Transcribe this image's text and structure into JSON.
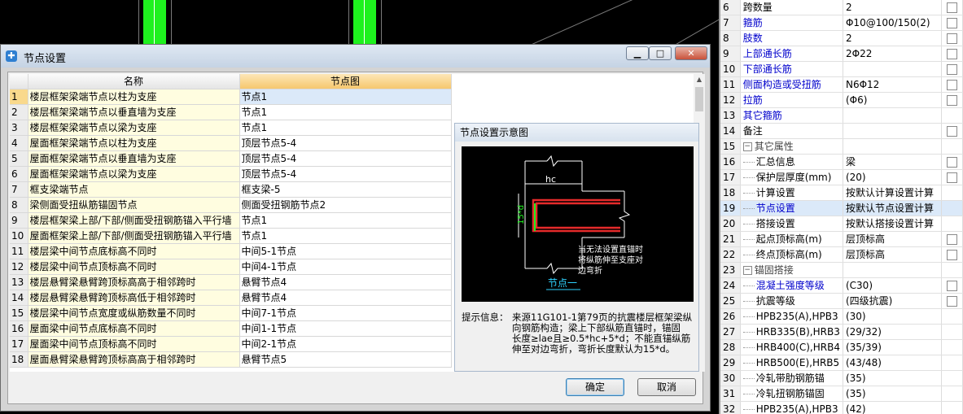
{
  "dialog": {
    "title": "节点设置",
    "window_buttons": {
      "minimize": "▁",
      "maximize": "□",
      "close": "✕"
    },
    "columns": {
      "name": "名称",
      "node": "节点图"
    },
    "rows": [
      {
        "num": "1",
        "name": "楼层框架梁端节点以柱为支座",
        "node": "节点1"
      },
      {
        "num": "2",
        "name": "楼层框架梁端节点以垂直墙为支座",
        "node": "节点1"
      },
      {
        "num": "3",
        "name": "楼层框架梁端节点以梁为支座",
        "node": "节点1"
      },
      {
        "num": "4",
        "name": "屋面框架梁端节点以柱为支座",
        "node": "顶层节点5-4"
      },
      {
        "num": "5",
        "name": "屋面框架梁端节点以垂直墙为支座",
        "node": "顶层节点5-4"
      },
      {
        "num": "6",
        "name": "屋面框架梁端节点以梁为支座",
        "node": "顶层节点5-4"
      },
      {
        "num": "7",
        "name": "框支梁端节点",
        "node": "框支梁-5"
      },
      {
        "num": "8",
        "name": "梁侧面受扭纵筋锚固节点",
        "node": "侧面受扭钢筋节点2"
      },
      {
        "num": "9",
        "name": "楼层框架梁上部/下部/侧面受扭钢筋锚入平行墙",
        "node": "节点1"
      },
      {
        "num": "10",
        "name": "屋面框架梁上部/下部/侧面受扭钢筋锚入平行墙",
        "node": "节点1"
      },
      {
        "num": "11",
        "name": "楼层梁中间节点底标高不同时",
        "node": "中间5-1节点"
      },
      {
        "num": "12",
        "name": "楼层梁中间节点顶标高不同时",
        "node": "中间4-1节点"
      },
      {
        "num": "13",
        "name": "楼层悬臂梁悬臂跨顶标高高于相邻跨时",
        "node": "悬臂节点4"
      },
      {
        "num": "14",
        "name": "楼层悬臂梁悬臂跨顶标高低于相邻跨时",
        "node": "悬臂节点4"
      },
      {
        "num": "15",
        "name": "楼层梁中间节点宽度或纵筋数量不同时",
        "node": "中间7-1节点"
      },
      {
        "num": "16",
        "name": "屋面梁中间节点底标高不同时",
        "node": "中间1-1节点"
      },
      {
        "num": "17",
        "name": "屋面梁中间节点顶标高不同时",
        "node": "中间2-1节点"
      },
      {
        "num": "18",
        "name": "屋面悬臂梁悬臂跨顶标高高于相邻跨时",
        "node": "悬臂节点5"
      }
    ],
    "preview": {
      "title": "节点设置示意图",
      "image_texts": {
        "hc": "hc",
        "dim": "15*d",
        "note": "当无法设置直锚时\n将纵筋伸至支座对\n边弯折",
        "caption": "节点一"
      },
      "info_label": "提示信息：",
      "info_text": "来源11G101-1第79页的抗震楼层框架梁纵\n向钢筋构造；梁上下部纵筋直锚时，锚固\n长度≥lae且≥0.5*hc+5*d；不能直锚纵筋\n伸至对边弯折，弯折长度默认为15*d。"
    },
    "ok_label": "确定",
    "cancel_label": "取消"
  },
  "properties": {
    "rows": [
      {
        "num": "6",
        "label": "跨数量",
        "value": "2",
        "style": "normal",
        "check": true
      },
      {
        "num": "7",
        "label": "箍筋",
        "value": "Φ10@100/150(2)",
        "style": "blue",
        "check": true
      },
      {
        "num": "8",
        "label": "肢数",
        "value": "2",
        "style": "blue",
        "check": true
      },
      {
        "num": "9",
        "label": "上部通长筋",
        "value": "2Φ22",
        "style": "blue",
        "check": true
      },
      {
        "num": "10",
        "label": "下部通长筋",
        "value": "",
        "style": "blue",
        "check": true
      },
      {
        "num": "11",
        "label": "侧面构造或受扭筋",
        "value": "N6Φ12",
        "style": "blue",
        "check": true
      },
      {
        "num": "12",
        "label": "拉筋",
        "value": "(Φ6)",
        "style": "blue",
        "check": true
      },
      {
        "num": "13",
        "label": "其它箍筋",
        "value": "",
        "style": "blue",
        "check": false
      },
      {
        "num": "14",
        "label": "备注",
        "value": "",
        "style": "normal",
        "check": true
      },
      {
        "num": "15",
        "label": "其它属性",
        "value": "",
        "style": "group",
        "check": false
      },
      {
        "num": "16",
        "label": "汇总信息",
        "value": "梁",
        "style": "child",
        "check": true
      },
      {
        "num": "17",
        "label": "保护层厚度(mm)",
        "value": "(20)",
        "style": "child",
        "check": true
      },
      {
        "num": "18",
        "label": "计算设置",
        "value": "按默认计算设置计算",
        "style": "child",
        "check": false
      },
      {
        "num": "19",
        "label": "节点设置",
        "value": "按默认节点设置计算",
        "style": "selected",
        "check": false
      },
      {
        "num": "20",
        "label": "搭接设置",
        "value": "按默认搭接设置计算",
        "style": "child",
        "check": false
      },
      {
        "num": "21",
        "label": "起点顶标高(m)",
        "value": "层顶标高",
        "style": "child",
        "check": true
      },
      {
        "num": "22",
        "label": "终点顶标高(m)",
        "value": "层顶标高",
        "style": "child",
        "check": true
      },
      {
        "num": "23",
        "label": "锚固搭接",
        "value": "",
        "style": "group",
        "check": false
      },
      {
        "num": "24",
        "label": "混凝土强度等级",
        "value": "(C30)",
        "style": "childblue",
        "check": true
      },
      {
        "num": "25",
        "label": "抗震等级",
        "value": "(四级抗震)",
        "style": "child",
        "check": true
      },
      {
        "num": "26",
        "label": "HPB235(A),HPB3",
        "value": "(30)",
        "style": "child",
        "check": false
      },
      {
        "num": "27",
        "label": "HRB335(B),HRB3",
        "value": "(29/32)",
        "style": "child",
        "check": false
      },
      {
        "num": "28",
        "label": "HRB400(C),HRB4",
        "value": "(35/39)",
        "style": "child",
        "check": false
      },
      {
        "num": "29",
        "label": "HRB500(E),HRB5",
        "value": "(43/48)",
        "style": "child",
        "check": false
      },
      {
        "num": "30",
        "label": "冷轧带肋钢筋锚",
        "value": "(35)",
        "style": "child",
        "check": false
      },
      {
        "num": "31",
        "label": "冷轧扭钢筋锚固",
        "value": "(35)",
        "style": "child",
        "check": false
      },
      {
        "num": "32",
        "label": "HPB235(A),HPB3",
        "value": "(42)",
        "style": "child",
        "check": false
      }
    ]
  }
}
